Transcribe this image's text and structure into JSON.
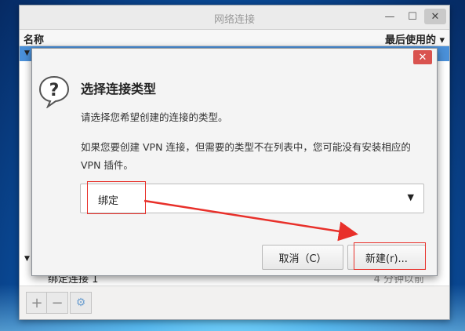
{
  "main_window": {
    "title": "网络连接",
    "columns": {
      "name": "名称",
      "last_used": "最后使用的 ▾"
    },
    "connection": {
      "name": "绑定连接 1",
      "last_used": "4 分钟以前"
    }
  },
  "dialog": {
    "close_glyph": "✕",
    "title": "选择连接类型",
    "description": "请选择您希望创建的连接的类型。",
    "info": "如果您要创建 VPN 连接，但需要的类型不在列表中，您可能没有安装相应的 VPN 插件。",
    "connection_type": {
      "selected": "绑定"
    },
    "buttons": {
      "cancel": "取消（C）",
      "create": "新建(r)..."
    }
  },
  "toolbar": {
    "add": "+",
    "remove": "−",
    "settings": "⚙"
  },
  "colors": {
    "annotation": "#e8302a",
    "selection": "#4a90d9",
    "dialog_close": "#d9534f"
  }
}
